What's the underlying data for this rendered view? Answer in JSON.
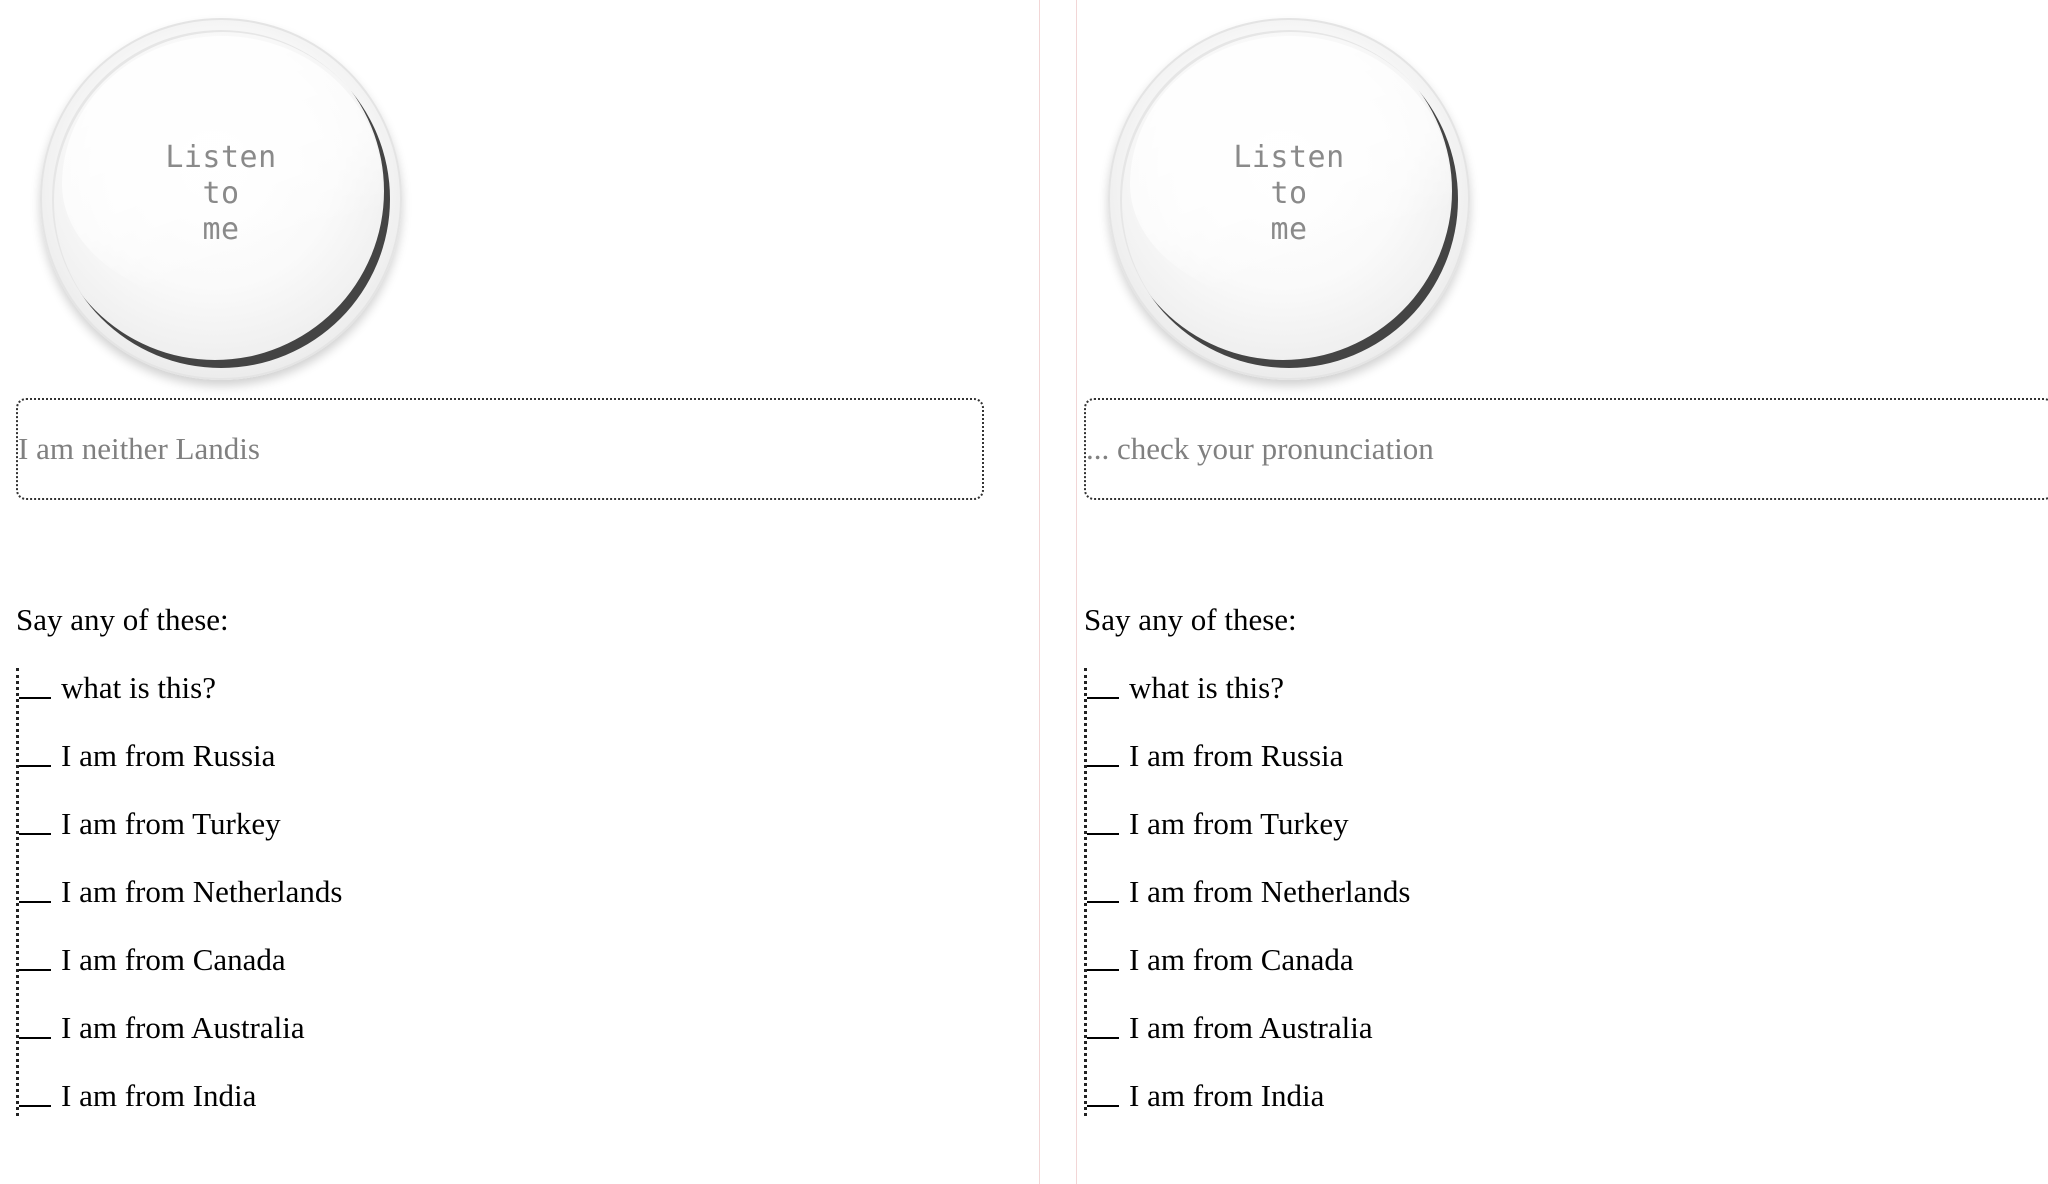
{
  "panels": [
    {
      "listen_button": {
        "line1": "Listen",
        "line2": "to",
        "line3": "me"
      },
      "speech_field": {
        "value": "I am neither Landis"
      },
      "say_heading": "Say any of these:",
      "phrases": [
        "what is this?",
        "I am from Russia",
        "I am from Turkey",
        "I am from Netherlands",
        "I am from Canada",
        "I am from Australia",
        "I am from India"
      ]
    },
    {
      "listen_button": {
        "line1": "Listen",
        "line2": "to",
        "line3": "me"
      },
      "speech_field": {
        "value": "... check your pronunciation"
      },
      "say_heading": "Say any of these:",
      "phrases": [
        "what is this?",
        "I am from Russia",
        "I am from Turkey",
        "I am from Netherlands",
        "I am from Canada",
        "I am from Australia",
        "I am from India"
      ]
    }
  ],
  "colors": {
    "field_text": "#808080",
    "button_text": "#8a8a8a",
    "divider": "#f2d6d6"
  }
}
